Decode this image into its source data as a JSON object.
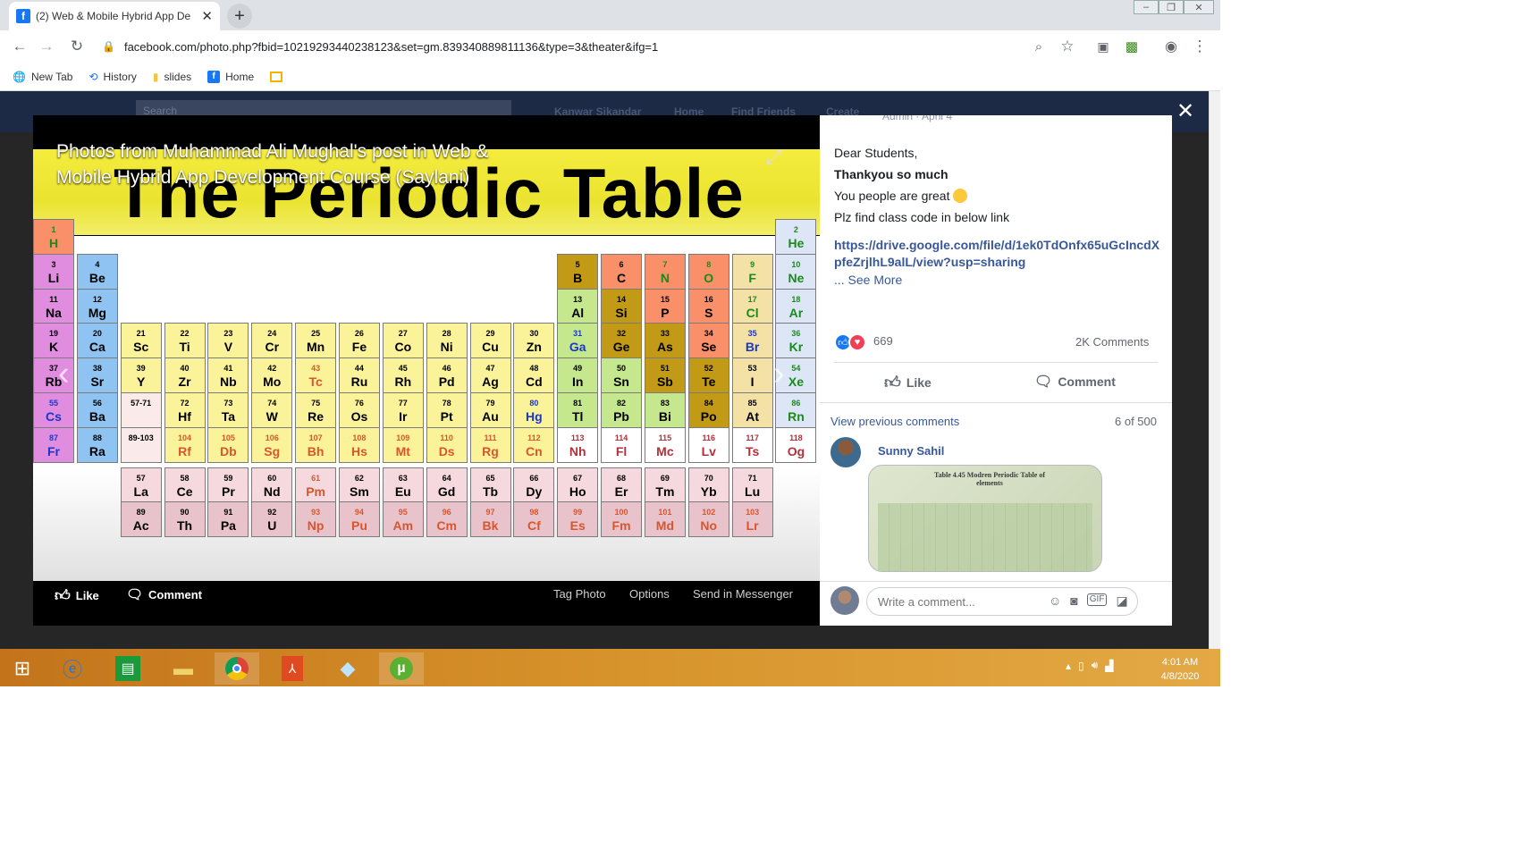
{
  "browser": {
    "tab_title": "(2) Web & Mobile Hybrid App De",
    "url": "facebook.com/photo.php?fbid=10219293440238123&set=gm.839340889811136&type=3&theater&ifg=1",
    "bookmarks": [
      {
        "label": "New Tab",
        "icon": "globe-icon"
      },
      {
        "label": "History",
        "icon": "history-icon"
      },
      {
        "label": "slides",
        "icon": "folder-icon"
      },
      {
        "label": "Home",
        "icon": "facebook-icon"
      }
    ]
  },
  "facebook_header": {
    "search_placeholder": "Search",
    "user_name": "Kanwar Sikandar",
    "nav": [
      "Home",
      "Find Friends",
      "Create"
    ]
  },
  "photo": {
    "caption": "Photos from Muhammad Ali Mughal's post in Web & Mobile Hybrid App Development Course (Saylani)",
    "image_title": "The Periodic Table",
    "actions": {
      "like": "Like",
      "comment": "Comment",
      "tag": "Tag Photo",
      "options": "Options",
      "send": "Send in Messenger"
    },
    "elements": [
      {
        "n": "1",
        "s": "H",
        "c": "#f9906a",
        "t": "#1a8a1a",
        "col": 0,
        "row": 0
      },
      {
        "n": "2",
        "s": "He",
        "c": "#dde6f7",
        "t": "#1a8a1a",
        "col": 17,
        "row": 0
      },
      {
        "n": "3",
        "s": "Li",
        "c": "#e08de0",
        "t": "#000",
        "col": 0,
        "row": 1
      },
      {
        "n": "4",
        "s": "Be",
        "c": "#8fc3f2",
        "t": "#000",
        "col": 1,
        "row": 1
      },
      {
        "n": "5",
        "s": "B",
        "c": "#c39a16",
        "t": "#000",
        "col": 12,
        "row": 1
      },
      {
        "n": "6",
        "s": "C",
        "c": "#f9906a",
        "t": "#000",
        "col": 13,
        "row": 1
      },
      {
        "n": "7",
        "s": "N",
        "c": "#f9906a",
        "t": "#1a8a1a",
        "col": 14,
        "row": 1
      },
      {
        "n": "8",
        "s": "O",
        "c": "#f9906a",
        "t": "#1a8a1a",
        "col": 15,
        "row": 1
      },
      {
        "n": "9",
        "s": "F",
        "c": "#f3e1a5",
        "t": "#1a8a1a",
        "col": 16,
        "row": 1
      },
      {
        "n": "10",
        "s": "Ne",
        "c": "#dde6f7",
        "t": "#1a8a1a",
        "col": 17,
        "row": 1
      },
      {
        "n": "11",
        "s": "Na",
        "c": "#e08de0",
        "t": "#000",
        "col": 0,
        "row": 2
      },
      {
        "n": "12",
        "s": "Mg",
        "c": "#8fc3f2",
        "t": "#000",
        "col": 1,
        "row": 2
      },
      {
        "n": "13",
        "s": "Al",
        "c": "#c5e88f",
        "t": "#000",
        "col": 12,
        "row": 2
      },
      {
        "n": "14",
        "s": "Si",
        "c": "#c39a16",
        "t": "#000",
        "col": 13,
        "row": 2
      },
      {
        "n": "15",
        "s": "P",
        "c": "#f9906a",
        "t": "#000",
        "col": 14,
        "row": 2
      },
      {
        "n": "16",
        "s": "S",
        "c": "#f9906a",
        "t": "#000",
        "col": 15,
        "row": 2
      },
      {
        "n": "17",
        "s": "Cl",
        "c": "#f3e1a5",
        "t": "#1a8a1a",
        "col": 16,
        "row": 2
      },
      {
        "n": "18",
        "s": "Ar",
        "c": "#dde6f7",
        "t": "#1a8a1a",
        "col": 17,
        "row": 2
      },
      {
        "n": "19",
        "s": "K",
        "c": "#e08de0",
        "t": "#000",
        "col": 0,
        "row": 3
      },
      {
        "n": "20",
        "s": "Ca",
        "c": "#8fc3f2",
        "t": "#000",
        "col": 1,
        "row": 3
      },
      {
        "n": "21",
        "s": "Sc",
        "c": "#fbf39a",
        "t": "#000",
        "col": 2,
        "row": 3
      },
      {
        "n": "22",
        "s": "Ti",
        "c": "#fbf39a",
        "t": "#000",
        "col": 3,
        "row": 3
      },
      {
        "n": "23",
        "s": "V",
        "c": "#fbf39a",
        "t": "#000",
        "col": 4,
        "row": 3
      },
      {
        "n": "24",
        "s": "Cr",
        "c": "#fbf39a",
        "t": "#000",
        "col": 5,
        "row": 3
      },
      {
        "n": "25",
        "s": "Mn",
        "c": "#fbf39a",
        "t": "#000",
        "col": 6,
        "row": 3
      },
      {
        "n": "26",
        "s": "Fe",
        "c": "#fbf39a",
        "t": "#000",
        "col": 7,
        "row": 3
      },
      {
        "n": "27",
        "s": "Co",
        "c": "#fbf39a",
        "t": "#000",
        "col": 8,
        "row": 3
      },
      {
        "n": "28",
        "s": "Ni",
        "c": "#fbf39a",
        "t": "#000",
        "col": 9,
        "row": 3
      },
      {
        "n": "29",
        "s": "Cu",
        "c": "#fbf39a",
        "t": "#000",
        "col": 10,
        "row": 3
      },
      {
        "n": "30",
        "s": "Zn",
        "c": "#fbf39a",
        "t": "#000",
        "col": 11,
        "row": 3
      },
      {
        "n": "31",
        "s": "Ga",
        "c": "#c5e88f",
        "t": "#1b36c8",
        "col": 12,
        "row": 3
      },
      {
        "n": "32",
        "s": "Ge",
        "c": "#c39a16",
        "t": "#000",
        "col": 13,
        "row": 3
      },
      {
        "n": "33",
        "s": "As",
        "c": "#c39a16",
        "t": "#000",
        "col": 14,
        "row": 3
      },
      {
        "n": "34",
        "s": "Se",
        "c": "#f9906a",
        "t": "#000",
        "col": 15,
        "row": 3
      },
      {
        "n": "35",
        "s": "Br",
        "c": "#f3e1a5",
        "t": "#1b36c8",
        "col": 16,
        "row": 3
      },
      {
        "n": "36",
        "s": "Kr",
        "c": "#dde6f7",
        "t": "#1a8a1a",
        "col": 17,
        "row": 3
      },
      {
        "n": "37",
        "s": "Rb",
        "c": "#e08de0",
        "t": "#000",
        "col": 0,
        "row": 4
      },
      {
        "n": "38",
        "s": "Sr",
        "c": "#8fc3f2",
        "t": "#000",
        "col": 1,
        "row": 4
      },
      {
        "n": "39",
        "s": "Y",
        "c": "#fbf39a",
        "t": "#000",
        "col": 2,
        "row": 4
      },
      {
        "n": "40",
        "s": "Zr",
        "c": "#fbf39a",
        "t": "#000",
        "col": 3,
        "row": 4
      },
      {
        "n": "41",
        "s": "Nb",
        "c": "#fbf39a",
        "t": "#000",
        "col": 4,
        "row": 4
      },
      {
        "n": "42",
        "s": "Mo",
        "c": "#fbf39a",
        "t": "#000",
        "col": 5,
        "row": 4
      },
      {
        "n": "43",
        "s": "Tc",
        "c": "#fbf39a",
        "t": "#d8562d",
        "col": 6,
        "row": 4
      },
      {
        "n": "44",
        "s": "Ru",
        "c": "#fbf39a",
        "t": "#000",
        "col": 7,
        "row": 4
      },
      {
        "n": "45",
        "s": "Rh",
        "c": "#fbf39a",
        "t": "#000",
        "col": 8,
        "row": 4
      },
      {
        "n": "46",
        "s": "Pd",
        "c": "#fbf39a",
        "t": "#000",
        "col": 9,
        "row": 4
      },
      {
        "n": "47",
        "s": "Ag",
        "c": "#fbf39a",
        "t": "#000",
        "col": 10,
        "row": 4
      },
      {
        "n": "48",
        "s": "Cd",
        "c": "#fbf39a",
        "t": "#000",
        "col": 11,
        "row": 4
      },
      {
        "n": "49",
        "s": "In",
        "c": "#c5e88f",
        "t": "#000",
        "col": 12,
        "row": 4
      },
      {
        "n": "50",
        "s": "Sn",
        "c": "#c5e88f",
        "t": "#000",
        "col": 13,
        "row": 4
      },
      {
        "n": "51",
        "s": "Sb",
        "c": "#c39a16",
        "t": "#000",
        "col": 14,
        "row": 4
      },
      {
        "n": "52",
        "s": "Te",
        "c": "#c39a16",
        "t": "#000",
        "col": 15,
        "row": 4
      },
      {
        "n": "53",
        "s": "I",
        "c": "#f3e1a5",
        "t": "#000",
        "col": 16,
        "row": 4
      },
      {
        "n": "54",
        "s": "Xe",
        "c": "#dde6f7",
        "t": "#1a8a1a",
        "col": 17,
        "row": 4
      },
      {
        "n": "55",
        "s": "Cs",
        "c": "#e08de0",
        "t": "#1b36c8",
        "col": 0,
        "row": 5
      },
      {
        "n": "56",
        "s": "Ba",
        "c": "#8fc3f2",
        "t": "#000",
        "col": 1,
        "row": 5
      },
      {
        "n": "57-71",
        "s": "",
        "c": "#fbeaea",
        "t": "#000",
        "col": 2,
        "row": 5
      },
      {
        "n": "72",
        "s": "Hf",
        "c": "#fbf39a",
        "t": "#000",
        "col": 3,
        "row": 5
      },
      {
        "n": "73",
        "s": "Ta",
        "c": "#fbf39a",
        "t": "#000",
        "col": 4,
        "row": 5
      },
      {
        "n": "74",
        "s": "W",
        "c": "#fbf39a",
        "t": "#000",
        "col": 5,
        "row": 5
      },
      {
        "n": "75",
        "s": "Re",
        "c": "#fbf39a",
        "t": "#000",
        "col": 6,
        "row": 5
      },
      {
        "n": "76",
        "s": "Os",
        "c": "#fbf39a",
        "t": "#000",
        "col": 7,
        "row": 5
      },
      {
        "n": "77",
        "s": "Ir",
        "c": "#fbf39a",
        "t": "#000",
        "col": 8,
        "row": 5
      },
      {
        "n": "78",
        "s": "Pt",
        "c": "#fbf39a",
        "t": "#000",
        "col": 9,
        "row": 5
      },
      {
        "n": "79",
        "s": "Au",
        "c": "#fbf39a",
        "t": "#000",
        "col": 10,
        "row": 5
      },
      {
        "n": "80",
        "s": "Hg",
        "c": "#fbf39a",
        "t": "#1b36c8",
        "col": 11,
        "row": 5
      },
      {
        "n": "81",
        "s": "Tl",
        "c": "#c5e88f",
        "t": "#000",
        "col": 12,
        "row": 5
      },
      {
        "n": "82",
        "s": "Pb",
        "c": "#c5e88f",
        "t": "#000",
        "col": 13,
        "row": 5
      },
      {
        "n": "83",
        "s": "Bi",
        "c": "#c5e88f",
        "t": "#000",
        "col": 14,
        "row": 5
      },
      {
        "n": "84",
        "s": "Po",
        "c": "#c39a16",
        "t": "#000",
        "col": 15,
        "row": 5
      },
      {
        "n": "85",
        "s": "At",
        "c": "#f3e1a5",
        "t": "#000",
        "col": 16,
        "row": 5
      },
      {
        "n": "86",
        "s": "Rn",
        "c": "#dde6f7",
        "t": "#1a8a1a",
        "col": 17,
        "row": 5
      },
      {
        "n": "87",
        "s": "Fr",
        "c": "#e08de0",
        "t": "#1b36c8",
        "col": 0,
        "row": 6
      },
      {
        "n": "88",
        "s": "Ra",
        "c": "#8fc3f2",
        "t": "#000",
        "col": 1,
        "row": 6
      },
      {
        "n": "89-103",
        "s": "",
        "c": "#fbeaea",
        "t": "#000",
        "col": 2,
        "row": 6
      },
      {
        "n": "104",
        "s": "Rf",
        "c": "#fbf39a",
        "t": "#d8562d",
        "col": 3,
        "row": 6
      },
      {
        "n": "105",
        "s": "Db",
        "c": "#fbf39a",
        "t": "#d8562d",
        "col": 4,
        "row": 6
      },
      {
        "n": "106",
        "s": "Sg",
        "c": "#fbf39a",
        "t": "#d8562d",
        "col": 5,
        "row": 6
      },
      {
        "n": "107",
        "s": "Bh",
        "c": "#fbf39a",
        "t": "#d8562d",
        "col": 6,
        "row": 6
      },
      {
        "n": "108",
        "s": "Hs",
        "c": "#fbf39a",
        "t": "#d8562d",
        "col": 7,
        "row": 6
      },
      {
        "n": "109",
        "s": "Mt",
        "c": "#fbf39a",
        "t": "#d8562d",
        "col": 8,
        "row": 6
      },
      {
        "n": "110",
        "s": "Ds",
        "c": "#fbf39a",
        "t": "#d8562d",
        "col": 9,
        "row": 6
      },
      {
        "n": "111",
        "s": "Rg",
        "c": "#fbf39a",
        "t": "#d8562d",
        "col": 10,
        "row": 6
      },
      {
        "n": "112",
        "s": "Cn",
        "c": "#fbf39a",
        "t": "#d8562d",
        "col": 11,
        "row": 6
      },
      {
        "n": "113",
        "s": "Nh",
        "c": "#ffffff",
        "t": "#b2303a",
        "col": 12,
        "row": 6
      },
      {
        "n": "114",
        "s": "Fl",
        "c": "#ffffff",
        "t": "#b2303a",
        "col": 13,
        "row": 6
      },
      {
        "n": "115",
        "s": "Mc",
        "c": "#ffffff",
        "t": "#b2303a",
        "col": 14,
        "row": 6
      },
      {
        "n": "116",
        "s": "Lv",
        "c": "#ffffff",
        "t": "#b2303a",
        "col": 15,
        "row": 6
      },
      {
        "n": "117",
        "s": "Ts",
        "c": "#ffffff",
        "t": "#b2303a",
        "col": 16,
        "row": 6
      },
      {
        "n": "118",
        "s": "Og",
        "c": "#ffffff",
        "t": "#b2303a",
        "col": 17,
        "row": 6
      },
      {
        "n": "57",
        "s": "La",
        "c": "#f6d9df",
        "t": "#000",
        "col": 2,
        "row": 7
      },
      {
        "n": "58",
        "s": "Ce",
        "c": "#f6d9df",
        "t": "#000",
        "col": 3,
        "row": 7
      },
      {
        "n": "59",
        "s": "Pr",
        "c": "#f6d9df",
        "t": "#000",
        "col": 4,
        "row": 7
      },
      {
        "n": "60",
        "s": "Nd",
        "c": "#f6d9df",
        "t": "#000",
        "col": 5,
        "row": 7
      },
      {
        "n": "61",
        "s": "Pm",
        "c": "#f6d9df",
        "t": "#d8562d",
        "col": 6,
        "row": 7
      },
      {
        "n": "62",
        "s": "Sm",
        "c": "#f6d9df",
        "t": "#000",
        "col": 7,
        "row": 7
      },
      {
        "n": "63",
        "s": "Eu",
        "c": "#f6d9df",
        "t": "#000",
        "col": 8,
        "row": 7
      },
      {
        "n": "64",
        "s": "Gd",
        "c": "#f6d9df",
        "t": "#000",
        "col": 9,
        "row": 7
      },
      {
        "n": "65",
        "s": "Tb",
        "c": "#f6d9df",
        "t": "#000",
        "col": 10,
        "row": 7
      },
      {
        "n": "66",
        "s": "Dy",
        "c": "#f6d9df",
        "t": "#000",
        "col": 11,
        "row": 7
      },
      {
        "n": "67",
        "s": "Ho",
        "c": "#f6d9df",
        "t": "#000",
        "col": 12,
        "row": 7
      },
      {
        "n": "68",
        "s": "Er",
        "c": "#f6d9df",
        "t": "#000",
        "col": 13,
        "row": 7
      },
      {
        "n": "69",
        "s": "Tm",
        "c": "#f6d9df",
        "t": "#000",
        "col": 14,
        "row": 7
      },
      {
        "n": "70",
        "s": "Yb",
        "c": "#f6d9df",
        "t": "#000",
        "col": 15,
        "row": 7
      },
      {
        "n": "71",
        "s": "Lu",
        "c": "#f6d9df",
        "t": "#000",
        "col": 16,
        "row": 7
      },
      {
        "n": "89",
        "s": "Ac",
        "c": "#e8c3cc",
        "t": "#000",
        "col": 2,
        "row": 8
      },
      {
        "n": "90",
        "s": "Th",
        "c": "#e8c3cc",
        "t": "#000",
        "col": 3,
        "row": 8
      },
      {
        "n": "91",
        "s": "Pa",
        "c": "#e8c3cc",
        "t": "#000",
        "col": 4,
        "row": 8
      },
      {
        "n": "92",
        "s": "U",
        "c": "#e8c3cc",
        "t": "#000",
        "col": 5,
        "row": 8
      },
      {
        "n": "93",
        "s": "Np",
        "c": "#e8c3cc",
        "t": "#d8562d",
        "col": 6,
        "row": 8
      },
      {
        "n": "94",
        "s": "Pu",
        "c": "#e8c3cc",
        "t": "#d8562d",
        "col": 7,
        "row": 8
      },
      {
        "n": "95",
        "s": "Am",
        "c": "#e8c3cc",
        "t": "#d8562d",
        "col": 8,
        "row": 8
      },
      {
        "n": "96",
        "s": "Cm",
        "c": "#e8c3cc",
        "t": "#d8562d",
        "col": 9,
        "row": 8
      },
      {
        "n": "97",
        "s": "Bk",
        "c": "#e8c3cc",
        "t": "#d8562d",
        "col": 10,
        "row": 8
      },
      {
        "n": "98",
        "s": "Cf",
        "c": "#e8c3cc",
        "t": "#d8562d",
        "col": 11,
        "row": 8
      },
      {
        "n": "99",
        "s": "Es",
        "c": "#e8c3cc",
        "t": "#d8562d",
        "col": 12,
        "row": 8
      },
      {
        "n": "100",
        "s": "Fm",
        "c": "#e8c3cc",
        "t": "#d8562d",
        "col": 13,
        "row": 8
      },
      {
        "n": "101",
        "s": "Md",
        "c": "#e8c3cc",
        "t": "#d8562d",
        "col": 14,
        "row": 8
      },
      {
        "n": "102",
        "s": "No",
        "c": "#e8c3cc",
        "t": "#d8562d",
        "col": 15,
        "row": 8
      },
      {
        "n": "103",
        "s": "Lr",
        "c": "#e8c3cc",
        "t": "#d8562d",
        "col": 16,
        "row": 8
      }
    ]
  },
  "post": {
    "meta_author": "Admin",
    "meta_date": "April 4",
    "greeting": "Dear Students,",
    "thanks": "Thankyou so much",
    "line2": "You people are great",
    "line3": "Plz find class code in below link",
    "link": "https://drive.google.com/file/d/1ek0TdOnfx65uGcIncdXpfeZrjlhL9alL/view?usp=sharing",
    "see_more": "... See More",
    "reaction_count": "669",
    "comments_count": "2K Comments",
    "like_label": "Like",
    "comment_label": "Comment",
    "view_previous": "View previous comments",
    "previous_count": "6 of 500",
    "commenter": "Sunny Sahil",
    "comment_image_caption": "Table 4.45 Modren Periodic Table of elements",
    "write_placeholder": "Write a comment..."
  },
  "taskbar": {
    "time": "4:01 AM",
    "date": "4/8/2020"
  }
}
